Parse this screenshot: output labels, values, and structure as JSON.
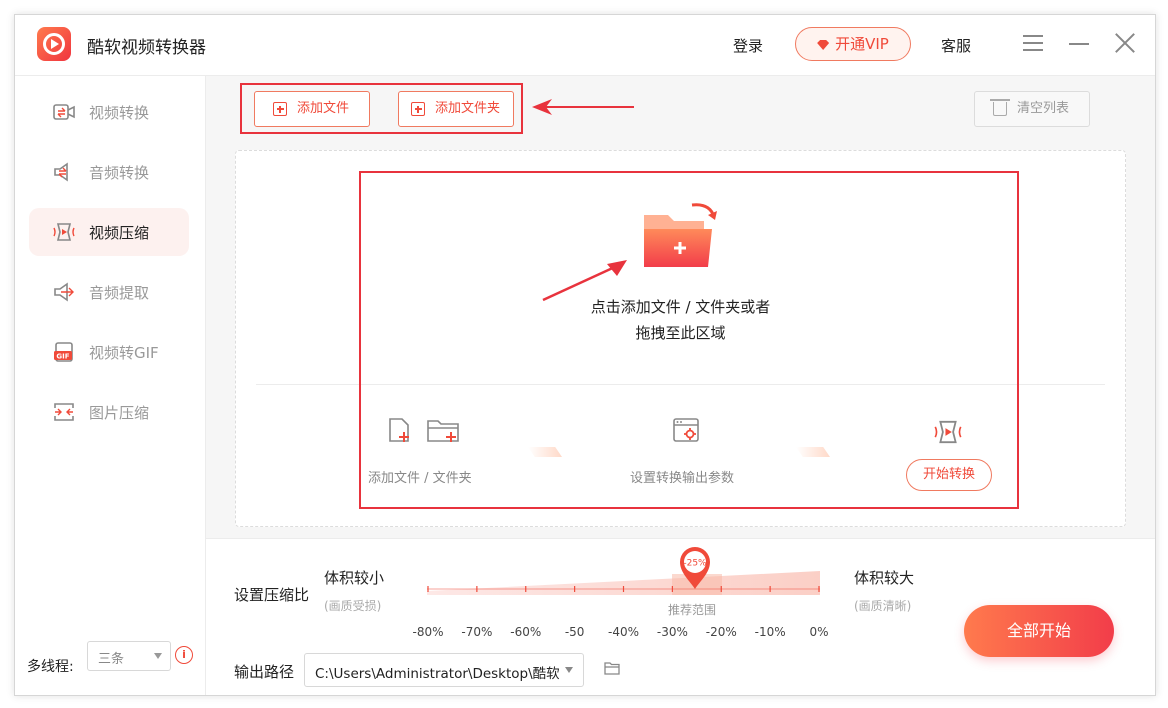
{
  "app": {
    "title": "酷软视频转换器"
  },
  "header": {
    "login_label": "登录",
    "vip_label": "开通VIP",
    "service_label": "客服"
  },
  "sidebar": {
    "items": [
      {
        "label": "视频转换",
        "icon": "video-convert-icon",
        "active": false
      },
      {
        "label": "音频转换",
        "icon": "audio-convert-icon",
        "active": false
      },
      {
        "label": "视频压缩",
        "icon": "video-compress-icon",
        "active": true
      },
      {
        "label": "音频提取",
        "icon": "audio-extract-icon",
        "active": false
      },
      {
        "label": "视频转GIF",
        "icon": "gif-icon",
        "active": false
      },
      {
        "label": "图片压缩",
        "icon": "image-compress-icon",
        "active": false
      }
    ],
    "threads_label": "多线程:",
    "threads_value": "三条"
  },
  "toolbar": {
    "add_file_label": "添加文件",
    "add_folder_label": "添加文件夹",
    "clear_label": "清空列表"
  },
  "dropzone": {
    "line1": "点击添加文件 / 文件夹或者",
    "line2": "拖拽至此区域",
    "step1": "添加文件 / 文件夹",
    "step2": "设置转换输出参数",
    "start_label": "开始转换"
  },
  "compression": {
    "label": "设置压缩比",
    "small_label": "体积较小",
    "small_sub": "(画质受损)",
    "large_label": "体积较大",
    "large_sub": "(画质清晰)",
    "current_value": "-25%",
    "current_percent": -25,
    "recommend_label": "推荐范围",
    "ticks": [
      "-80%",
      "-70%",
      "-60%",
      "-50",
      "-40%",
      "-30%",
      "-20%",
      "-10%",
      "0%"
    ]
  },
  "output": {
    "label": "输出路径",
    "path": "C:\\Users\\Administrator\\Desktop\\酷软"
  },
  "actions": {
    "start_all_label": "全部开始"
  },
  "colors": {
    "accent": "#f04a3a",
    "accent_light": "#ff7a4d",
    "annotation_red": "#e8333d"
  }
}
